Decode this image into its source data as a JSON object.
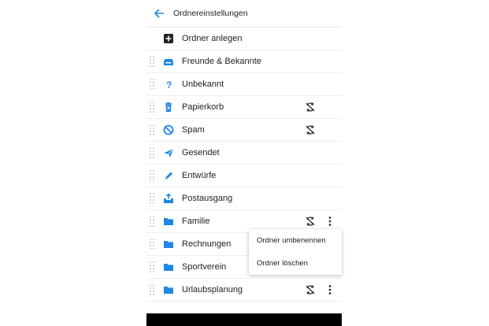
{
  "header": {
    "title": "Ordnereinstellungen"
  },
  "accent": "#1e88e5",
  "rows": [
    {
      "label": "Ordner anlegen",
      "icon": "add-box-icon",
      "draggable": false,
      "sync_off": false,
      "more": false
    },
    {
      "label": "Freunde & Bekannte",
      "icon": "inbox-icon",
      "draggable": true,
      "sync_off": false,
      "more": false
    },
    {
      "label": "Unbekannt",
      "icon": "question-icon",
      "draggable": true,
      "sync_off": false,
      "more": false
    },
    {
      "label": "Papierkorb",
      "icon": "trash-icon",
      "draggable": true,
      "sync_off": true,
      "more": false
    },
    {
      "label": "Spam",
      "icon": "block-icon",
      "draggable": true,
      "sync_off": true,
      "more": false
    },
    {
      "label": "Gesendet",
      "icon": "send-icon",
      "draggable": true,
      "sync_off": false,
      "more": false
    },
    {
      "label": "Entwürfe",
      "icon": "pen-icon",
      "draggable": true,
      "sync_off": false,
      "more": false
    },
    {
      "label": "Postausgang",
      "icon": "outbox-icon",
      "draggable": true,
      "sync_off": false,
      "more": false
    },
    {
      "label": "Familie",
      "icon": "folder-icon",
      "draggable": true,
      "sync_off": true,
      "more": true
    },
    {
      "label": "Rechnungen",
      "icon": "folder-icon",
      "draggable": true,
      "sync_off": false,
      "more": false
    },
    {
      "label": "Sportverein",
      "icon": "folder-icon",
      "draggable": true,
      "sync_off": false,
      "more": false
    },
    {
      "label": "Urlaubsplanung",
      "icon": "folder-icon",
      "draggable": true,
      "sync_off": true,
      "more": true
    }
  ],
  "context_menu": {
    "items": [
      {
        "label": "Ordner umbenennen"
      },
      {
        "label": "Ordner löschen"
      }
    ]
  }
}
